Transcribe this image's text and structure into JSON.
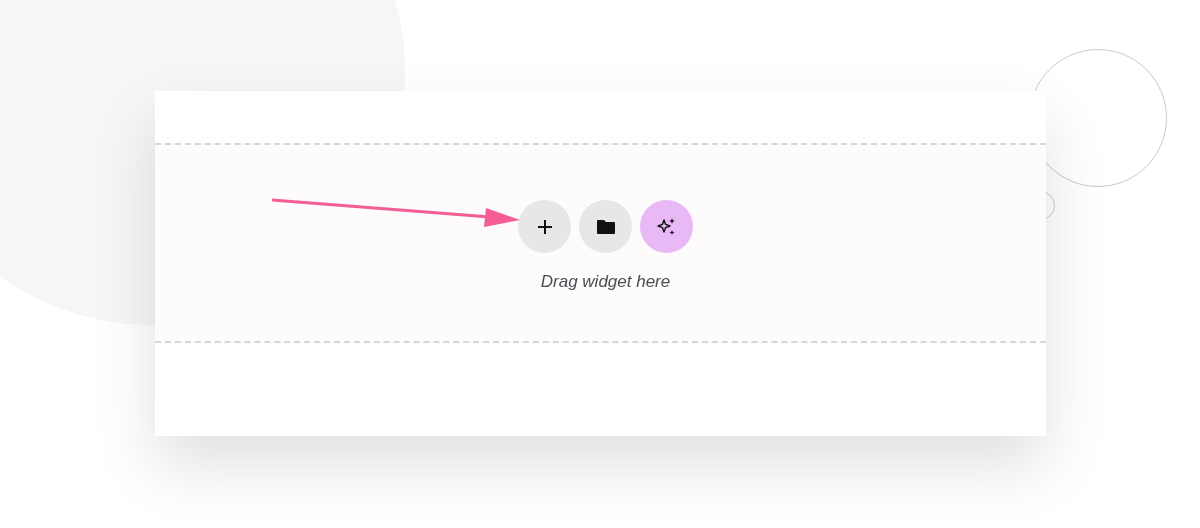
{
  "dropzone": {
    "buttons": [
      {
        "kind": "add"
      },
      {
        "kind": "template"
      },
      {
        "kind": "ai"
      }
    ],
    "hint": "Drag widget here"
  }
}
